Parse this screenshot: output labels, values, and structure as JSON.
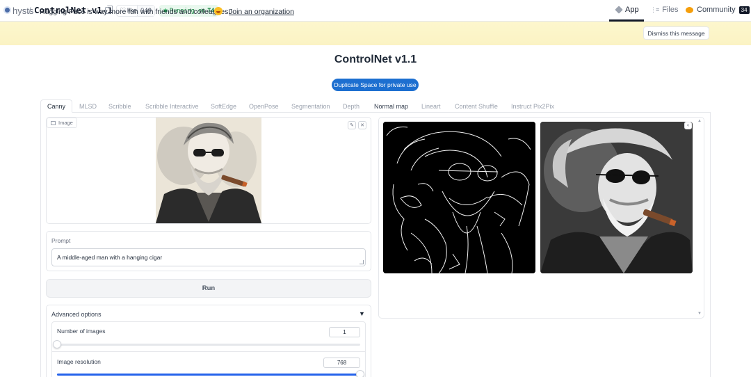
{
  "header": {
    "owner": "hysts",
    "separator": "/",
    "repo": "ControlNet-v1-1",
    "like_label": "like",
    "like_count": "949",
    "status_prefix": "Running on",
    "status_hardware": "T4",
    "nav": [
      {
        "label": "App",
        "icon": "app-icon"
      },
      {
        "label": "Files",
        "icon": "files-icon"
      },
      {
        "label": "Community",
        "icon": "community-icon",
        "badge": "34"
      }
    ]
  },
  "banner": {
    "text": "Hugging Face is way more fun with friends and colleagues!",
    "link": "Join an organization",
    "dismiss": "Dismiss this message"
  },
  "main": {
    "title": "ControlNet v1.1",
    "duplicate_button": "Duplicate Space for private use",
    "tabs": [
      {
        "label": "Canny",
        "active": true
      },
      {
        "label": "MLSD"
      },
      {
        "label": "Scribble"
      },
      {
        "label": "Scribble Interactive"
      },
      {
        "label": "SoftEdge"
      },
      {
        "label": "OpenPose"
      },
      {
        "label": "Segmentation"
      },
      {
        "label": "Depth"
      },
      {
        "label": "Normal map"
      },
      {
        "label": "Lineart"
      },
      {
        "label": "Content Shuffle"
      },
      {
        "label": "Instruct Pix2Pix"
      }
    ],
    "image_input": {
      "label": "Image",
      "edit_icon": "pencil-icon",
      "clear_icon": "close-icon"
    },
    "prompt": {
      "label": "Prompt",
      "value": "A middle-aged man with a hanging cigar"
    },
    "run_button": "Run",
    "advanced": {
      "label": "Advanced options",
      "caret": "▼",
      "num_images": {
        "label": "Number of images",
        "value": "1",
        "fraction": 0.0
      },
      "resolution": {
        "label": "Image resolution",
        "value": "768",
        "fraction": 1.0
      }
    }
  },
  "colors": {
    "accent": "#1d6fd0",
    "banner_bg": "#fdf7cd",
    "running_bg": "#e9f8ee",
    "slider_fill": "#2563eb"
  }
}
